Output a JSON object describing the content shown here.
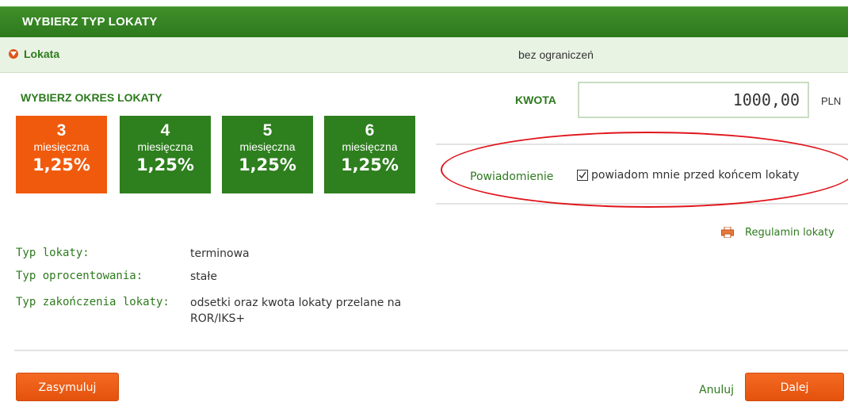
{
  "header": {
    "title": "WYBIERZ TYP LOKATY"
  },
  "subbar": {
    "lokata_label": "Lokata",
    "limit_text": "bez ograniczeń"
  },
  "okres": {
    "title": "WYBIERZ OKRES LOKATY",
    "tiles": [
      {
        "months": "3",
        "unit": "miesięczna",
        "rate": "1,25%",
        "selected": true
      },
      {
        "months": "4",
        "unit": "miesięczna",
        "rate": "1,25%",
        "selected": false
      },
      {
        "months": "5",
        "unit": "miesięczna",
        "rate": "1,25%",
        "selected": false
      },
      {
        "months": "6",
        "unit": "miesięczna",
        "rate": "1,25%",
        "selected": false
      }
    ]
  },
  "kwota": {
    "label": "KWOTA",
    "value": "1000,00",
    "currency": "PLN"
  },
  "notification": {
    "label": "Powiadomienie",
    "checkbox_text": "powiadom mnie przed końcem lokaty",
    "checked": true
  },
  "regulamin": {
    "text": "Regulamin lokaty",
    "icon": "printer-icon"
  },
  "info": [
    {
      "label": "Typ lokaty:",
      "value": "terminowa"
    },
    {
      "label": "Typ oprocentowania:",
      "value": "stałe"
    },
    {
      "label": "Typ zakończenia lokaty:",
      "value": "odsetki oraz kwota lokaty przelane na ROR/IKS+"
    }
  ],
  "buttons": {
    "simulate": "Zasymuluj",
    "cancel": "Anuluj",
    "next": "Dalej"
  },
  "colors": {
    "brand_green": "#2e7f1e",
    "accent_orange": "#f05a0c",
    "highlight_red": "#e0151c"
  }
}
